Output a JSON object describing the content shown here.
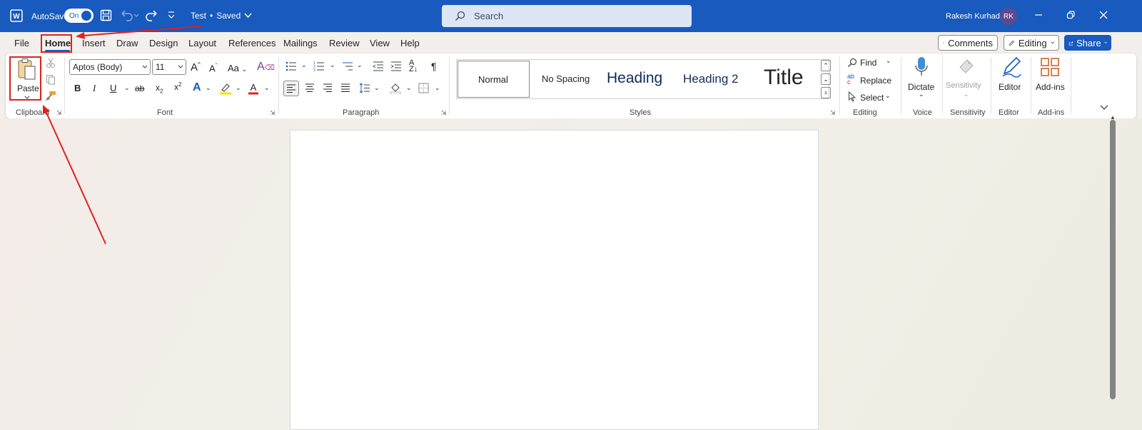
{
  "titlebar": {
    "autosave_label": "AutoSave",
    "autosave_state": "On",
    "doc_name": "Test",
    "doc_status": "Saved",
    "search_placeholder": "Search",
    "user_name": "Rakesh Kurhade",
    "user_initials": "RK"
  },
  "menu": {
    "tabs": [
      "File",
      "Home",
      "Insert",
      "Draw",
      "Design",
      "Layout",
      "References",
      "Mailings",
      "Review",
      "View",
      "Help"
    ],
    "comments_label": "Comments",
    "editing_label": "Editing",
    "share_label": "Share"
  },
  "ribbon": {
    "clipboard": {
      "paste_label": "Paste",
      "group_label": "Clipboard"
    },
    "font": {
      "font_name": "Aptos (Body)",
      "font_size": "11",
      "case_label": "Aa",
      "group_label": "Font"
    },
    "paragraph": {
      "group_label": "Paragraph"
    },
    "styles": {
      "items": [
        "Normal",
        "No Spacing",
        "Heading",
        "Heading 2",
        "Title"
      ],
      "group_label": "Styles"
    },
    "editing": {
      "find_label": "Find",
      "replace_label": "Replace",
      "select_label": "Select",
      "group_label": "Editing"
    },
    "voice": {
      "dictate_label": "Dictate",
      "group_label": "Voice"
    },
    "sensitivity": {
      "button_label": "Sensitivity",
      "group_label": "Sensitivity"
    },
    "editor": {
      "button_label": "Editor",
      "group_label": "Editor"
    },
    "addins": {
      "button_label": "Add-ins",
      "group_label": "Add-ins"
    }
  },
  "colors": {
    "titlebar": "#185abd",
    "annotation": "#e0201f",
    "highlight": "#f4e200",
    "font_color": "#e0201f"
  }
}
